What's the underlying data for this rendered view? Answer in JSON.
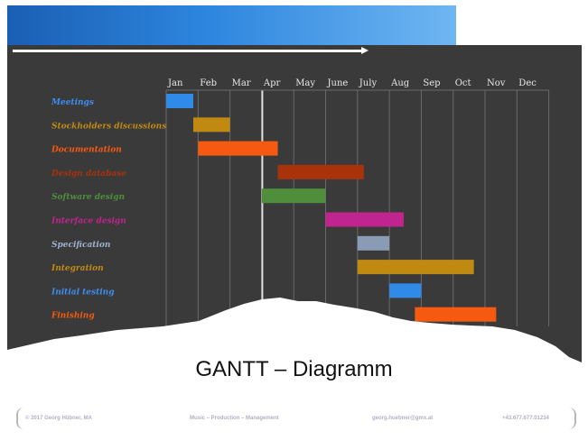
{
  "slide": {
    "subtitle": "GANTT – Diagramm",
    "footer": {
      "author": "© 2017 Georg Hübner, MA",
      "course": "Music – Production – Management",
      "email": "georg.huebner@gmx.at",
      "phone": "+43.677.677.01234"
    }
  },
  "chart_data": {
    "type": "gantt",
    "title": "",
    "months": [
      "Jan",
      "Feb",
      "Mar",
      "Apr",
      "May",
      "June",
      "July",
      "Aug",
      "Sep",
      "Oct",
      "Nov",
      "Dec"
    ],
    "today_marker_month": 3.0,
    "tasks": [
      {
        "name": "Meetings",
        "start": 0.0,
        "end": 0.85,
        "color": "#2f8ae8",
        "label_color": "#3d8ef0"
      },
      {
        "name": "Stockholders discussions",
        "start": 0.85,
        "end": 2.0,
        "color": "#c08a12",
        "label_color": "#c08a12"
      },
      {
        "name": "Documentation",
        "start": 1.0,
        "end": 3.5,
        "color": "#f55a10",
        "label_color": "#f55a10"
      },
      {
        "name": "Design database",
        "start": 3.5,
        "end": 6.2,
        "color": "#a8320a",
        "label_color": "#a8320a"
      },
      {
        "name": "Software design",
        "start": 3.0,
        "end": 5.0,
        "color": "#4f8e3a",
        "label_color": "#4f8e3a"
      },
      {
        "name": "Interface design",
        "start": 5.0,
        "end": 7.45,
        "color": "#c0248e",
        "label_color": "#c0248e"
      },
      {
        "name": "Specification",
        "start": 6.0,
        "end": 7.0,
        "color": "#8a9bb5",
        "label_color": "#9eb0cc"
      },
      {
        "name": "Integration",
        "start": 6.0,
        "end": 9.65,
        "color": "#c08a12",
        "label_color": "#c08a12"
      },
      {
        "name": "Initial testing",
        "start": 7.0,
        "end": 8.0,
        "color": "#2f8ae8",
        "label_color": "#3d8ef0"
      },
      {
        "name": "Finishing",
        "start": 7.8,
        "end": 10.35,
        "color": "#f55a10",
        "label_color": "#f55a10"
      }
    ]
  }
}
